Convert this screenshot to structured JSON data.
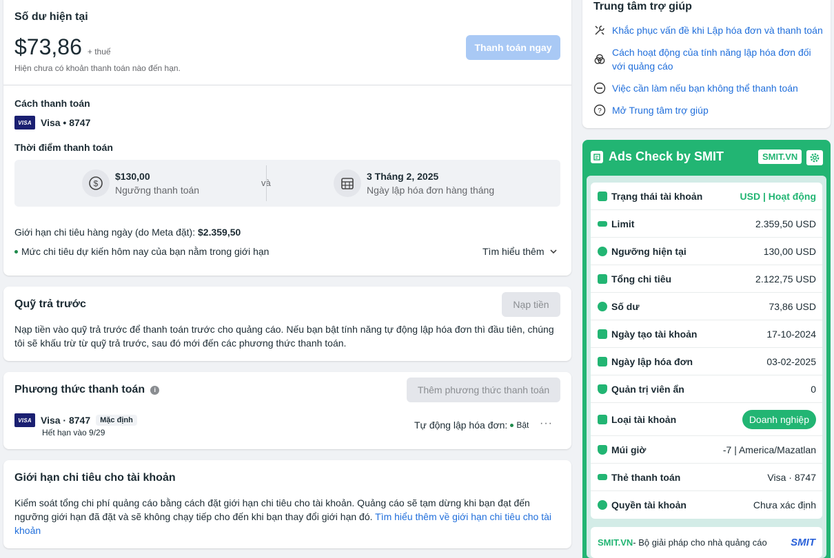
{
  "balance": {
    "title": "Số dư hiện tại",
    "amount": "$73,86",
    "tax": "+ thuế",
    "subtitle": "Hiện chưa có khoản thanh toán nào đến hạn.",
    "pay_now": "Thanh toán ngay",
    "method_label": "Cách thanh toán",
    "method_value": "Visa • 8747",
    "visa_badge": "VISA",
    "time_label": "Thời điểm thanh toán",
    "threshold_value": "$130,00",
    "threshold_label": "Ngưỡng thanh toán",
    "and": "và",
    "date_value": "3 Tháng 2, 2025",
    "date_label": "Ngày lập hóa đơn hàng tháng",
    "daily_limit_text": "Giới hạn chi tiêu hàng ngày (do Meta đặt): ",
    "daily_limit_value": "$2.359,50",
    "forecast": "Mức chi tiêu dự kiến hôm nay của bạn nằm trong giới hạn",
    "learn_more": "Tìm hiểu thêm"
  },
  "prepaid": {
    "title": "Quỹ trả trước",
    "button": "Nạp tiền",
    "description": "Nạp tiền vào quỹ trả trước để thanh toán trước cho quảng cáo. Nếu bạn bật tính năng tự động lập hóa đơn thì đầu tiên, chúng tôi sẽ khấu trừ từ quỹ trả trước, sau đó mới đến các phương thức thanh toán."
  },
  "payment_methods": {
    "title": "Phương thức thanh toán",
    "add_button": "Thêm phương thức thanh toán",
    "visa_badge": "VISA",
    "card": "Visa · 8747",
    "default_tag": "Mặc định",
    "expiry": "Hết hạn vào 9/29",
    "auto_billing": "Tự động lập hóa đơn:",
    "auto_status": "Bật",
    "more": "···"
  },
  "spend_limit": {
    "title": "Giới hạn chi tiêu cho tài khoản",
    "description": "Kiểm soát tổng chi phí quảng cáo bằng cách đặt giới hạn chi tiêu cho tài khoản. Quảng cáo sẽ tạm dừng khi bạn đạt đến ngưỡng giới hạn đã đặt và sẽ không chạy tiếp cho đến khi bạn thay đổi giới hạn đó. ",
    "link": "Tìm hiểu thêm về giới hạn chi tiêu cho tài khoản"
  },
  "help": {
    "title": "Trung tâm trợ giúp",
    "items": [
      {
        "label": "Khắc phục vấn đề khi Lập hóa đơn và thanh toán",
        "icon": "wrench-icon"
      },
      {
        "label": "Cách hoạt động của tính năng lập hóa đơn đối với quảng cáo",
        "icon": "venn-icon"
      },
      {
        "label": "Việc cần làm nếu bạn không thể thanh toán",
        "icon": "minus-circle-icon"
      },
      {
        "label": "Mở Trung tâm trợ giúp",
        "icon": "question-icon"
      }
    ]
  },
  "smit": {
    "title": "Ads Check by SMIT",
    "brand_tag": "SMIT.VN",
    "rows": [
      {
        "label": "Trạng thái tài khoản",
        "value": "USD | Hoạt động"
      },
      {
        "label": "Limit",
        "value": "2.359,50 USD"
      },
      {
        "label": "Ngưỡng hiện tại",
        "value": "130,00 USD"
      },
      {
        "label": "Tổng chi tiêu",
        "value": "2.122,75 USD"
      },
      {
        "label": "Số dư",
        "value": "73,86 USD"
      },
      {
        "label": "Ngày tạo tài khoản",
        "value": "17-10-2024"
      },
      {
        "label": "Ngày lập hóa đơn",
        "value": "03-02-2025"
      },
      {
        "label": "Quản trị viên ẩn",
        "value": "0"
      },
      {
        "label": "Loại tài khoản",
        "value": "Doanh nghiệp"
      },
      {
        "label": "Múi giờ",
        "value": "-7 | America/Mazatlan"
      },
      {
        "label": "Thẻ thanh toán",
        "value": "Visa · 8747"
      },
      {
        "label": "Quyền tài khoản",
        "value": "Chưa xác định"
      }
    ],
    "footer_brand": "SMIT.VN",
    "footer_text": " - Bộ giải pháp cho nhà quảng cáo",
    "footer_logo": "SMIT",
    "accent": "#22b573"
  }
}
